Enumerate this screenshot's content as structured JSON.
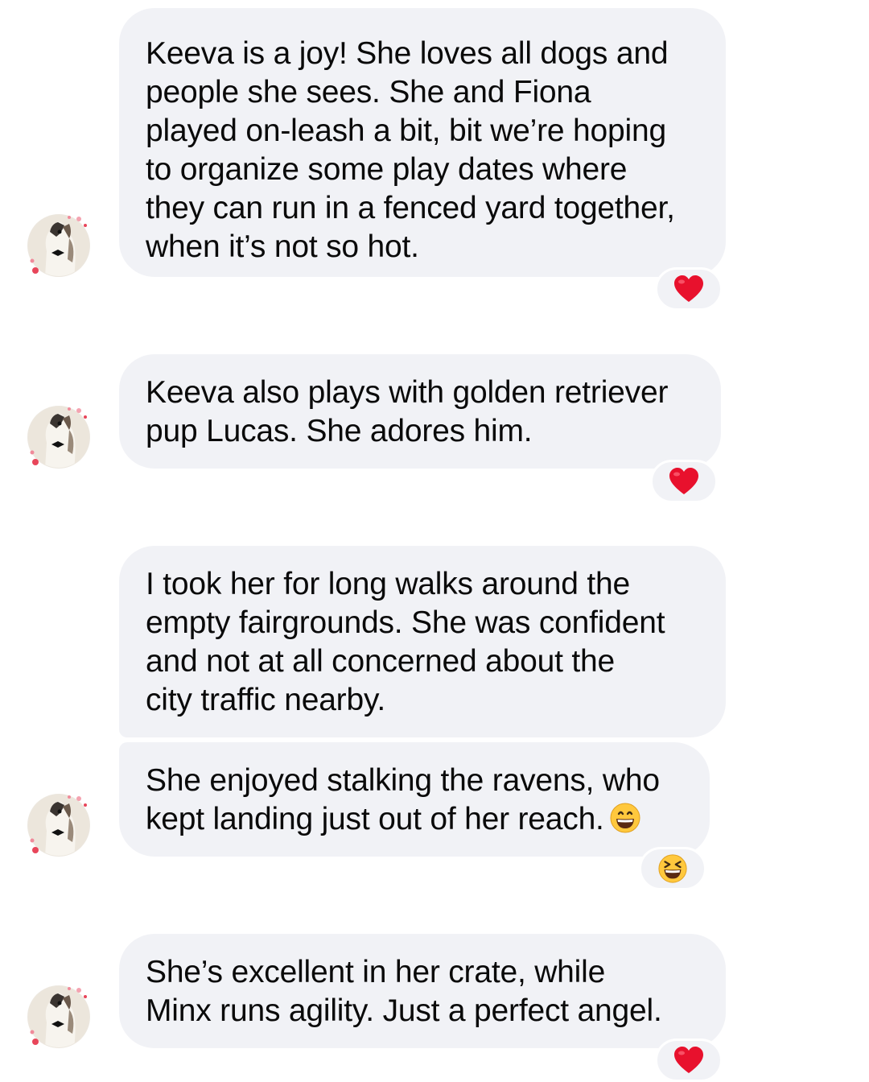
{
  "conversation": {
    "messages": [
      {
        "lines": [
          "Keeva is a joy! She loves all dogs and",
          "people she sees. She and Fiona",
          "played on-leash a bit, bit we’re hoping",
          "to organize some play dates where",
          "they can run in a fenced yard together,",
          "when it’s not so hot."
        ],
        "reaction": "red-heart"
      },
      {
        "lines": [
          "Keeva also plays with golden retriever",
          "pup Lucas. She adores him."
        ],
        "reaction": "red-heart"
      },
      {
        "lines": [
          "I took her for long walks around the",
          "empty fairgrounds. She was confident",
          "and not at all concerned about the",
          "city traffic nearby."
        ],
        "reaction": null
      },
      {
        "lines": [
          "She enjoyed stalking the ravens, who",
          "kept landing just out of her reach."
        ],
        "inline_emoji": "grinning-face-with-smiling-eyes",
        "reaction": "grinning-squinting-face"
      },
      {
        "lines": [
          "She’s excellent in her crate, while",
          "Minx runs agility. Just a perfect angel."
        ],
        "reaction": "red-heart"
      }
    ]
  },
  "colors": {
    "bubble": "#f1f2f6",
    "text": "#0a0a0a",
    "heart": "#e8112d",
    "emoji_face": "#ffc83d"
  },
  "icons": {
    "avatar": "dog-avatar-with-hearts",
    "heart": "heart-icon",
    "laugh": "laughing-emoji-icon"
  }
}
